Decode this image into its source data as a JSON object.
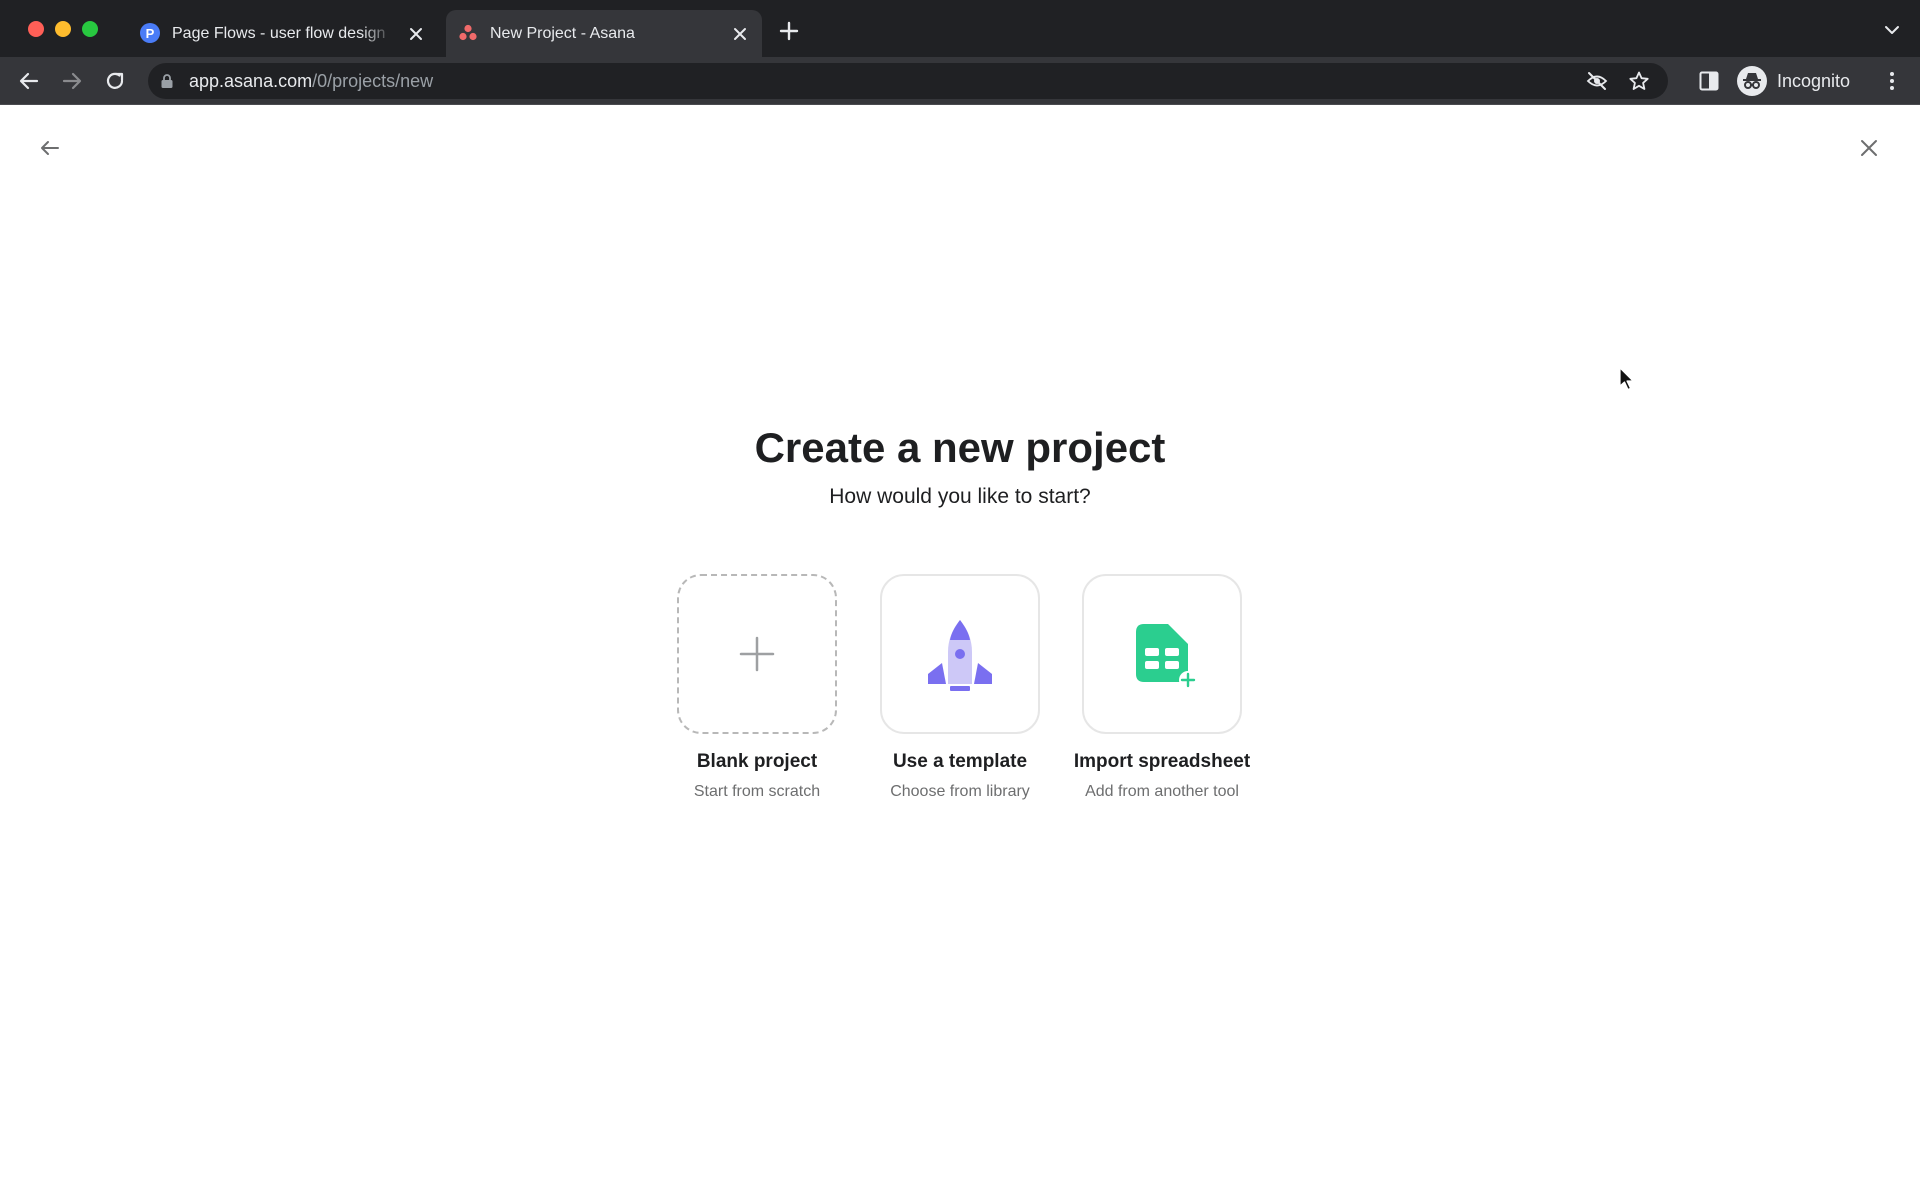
{
  "browser": {
    "tabs": [
      {
        "title": "Page Flows - user flow design",
        "favicon": "page-flows-icon",
        "active": false
      },
      {
        "title": "New Project - Asana",
        "favicon": "asana-icon",
        "active": true
      }
    ],
    "address": {
      "host": "app.asana.com",
      "path": "/0/projects/new"
    },
    "profile_label": "Incognito"
  },
  "page": {
    "title": "Create a new project",
    "subtitle": "How would you like to start?",
    "options": [
      {
        "title": "Blank project",
        "description": "Start from scratch",
        "icon": "plus-icon"
      },
      {
        "title": "Use a template",
        "description": "Choose from library",
        "icon": "rocket-icon"
      },
      {
        "title": "Import spreadsheet",
        "description": "Add from another tool",
        "icon": "spreadsheet-icon"
      }
    ]
  },
  "colors": {
    "chrome_dark": "#202124",
    "chrome_toolbar": "#35363a",
    "template_purple": "#7a6ff0",
    "import_green": "#2bce8f",
    "asana_coral": "#f06a6a"
  }
}
